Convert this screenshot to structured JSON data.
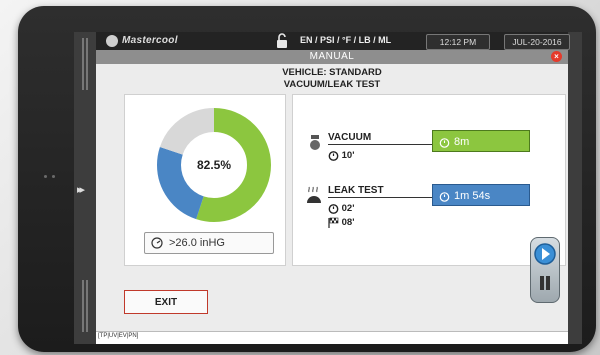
{
  "status_bar": {
    "brand": "Mastercool",
    "units": "EN / PSI / °F / LB / ML",
    "time": "12:12 PM",
    "date": "JUL-20-2016"
  },
  "window": {
    "title": "MANUAL",
    "close_label": "×"
  },
  "header": {
    "line1": "VEHICLE: STANDARD",
    "line2": "VACUUM/LEAK TEST"
  },
  "gauge": {
    "percent_label": "82.5%",
    "segments": [
      {
        "name": "green",
        "value": 0.55,
        "color": "#8cc63f"
      },
      {
        "name": "blue",
        "value": 0.25,
        "color": "#4a86c5"
      },
      {
        "name": "grey",
        "value": 0.2,
        "color": "#d8d8d8"
      }
    ],
    "readout": ">26.0 inHG"
  },
  "steps": {
    "vacuum": {
      "label": "VACUUM",
      "set_time": "10'",
      "elapsed": "8m",
      "color": "#8cc63f"
    },
    "leak_test": {
      "label": "LEAK TEST",
      "set_time": "02'",
      "finish_time": "08'",
      "elapsed": "1m 54s",
      "color": "#4a86c5"
    }
  },
  "buttons": {
    "exit": "EXIT"
  },
  "footer": {
    "text": "[TP|UV|EV|PN]"
  }
}
